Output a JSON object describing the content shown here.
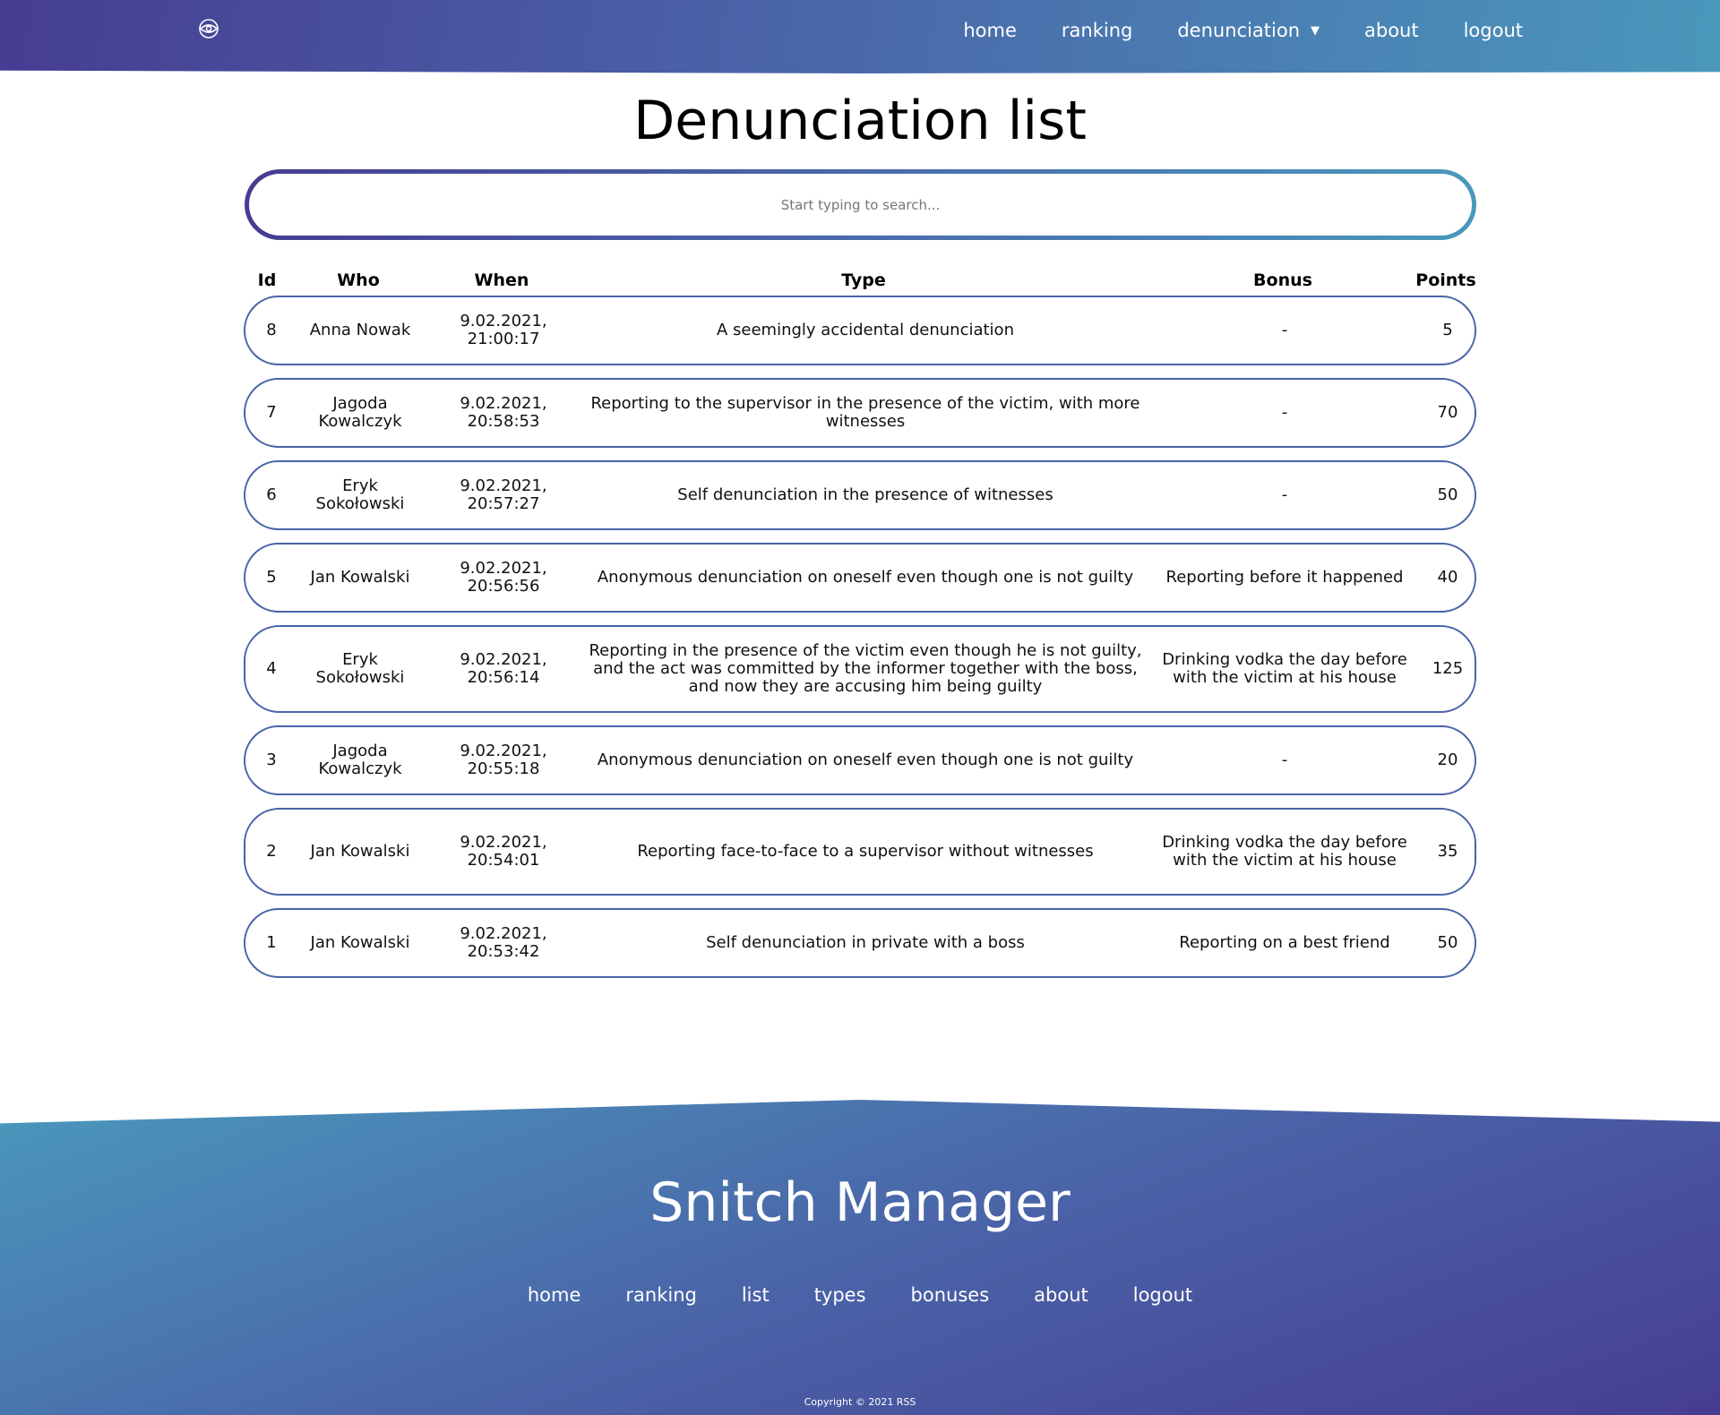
{
  "nav": {
    "logo_icon": "eye-icon",
    "items": [
      {
        "label": "home"
      },
      {
        "label": "ranking"
      },
      {
        "label": "denunciation",
        "caret": "▼"
      },
      {
        "label": "about"
      },
      {
        "label": "logout"
      }
    ]
  },
  "title": "Denunciation list",
  "search": {
    "placeholder": "Start typing to search...",
    "value": ""
  },
  "table": {
    "headers": {
      "id": "Id",
      "who": "Who",
      "when": "When",
      "type": "Type",
      "bonus": "Bonus",
      "points": "Points"
    },
    "rows": [
      {
        "id": "8",
        "who": "Anna Nowak",
        "when": "9.02.2021, 21:00:17",
        "type": "A seemingly accidental denunciation",
        "bonus": "-",
        "points": "5"
      },
      {
        "id": "7",
        "who": "Jagoda Kowalczyk",
        "when": "9.02.2021, 20:58:53",
        "type": "Reporting to the supervisor in the presence of the victim, with more witnesses",
        "bonus": "-",
        "points": "70"
      },
      {
        "id": "6",
        "who": "Eryk Sokołowski",
        "when": "9.02.2021, 20:57:27",
        "type": "Self denunciation in the presence of witnesses",
        "bonus": "-",
        "points": "50"
      },
      {
        "id": "5",
        "who": "Jan Kowalski",
        "when": "9.02.2021, 20:56:56",
        "type": "Anonymous denunciation on oneself even though one is not guilty",
        "bonus": "Reporting before it happened",
        "points": "40"
      },
      {
        "id": "4",
        "who": "Eryk Sokołowski",
        "when": "9.02.2021, 20:56:14",
        "type": "Reporting in the presence of the victim even though he is not guilty, and the act was committed by the informer together with the boss, and now they are accusing him being guilty",
        "bonus": "Drinking vodka the day before with the victim at his house",
        "points": "125"
      },
      {
        "id": "3",
        "who": "Jagoda Kowalczyk",
        "when": "9.02.2021, 20:55:18",
        "type": "Anonymous denunciation on oneself even though one is not guilty",
        "bonus": "-",
        "points": "20"
      },
      {
        "id": "2",
        "who": "Jan Kowalski",
        "when": "9.02.2021, 20:54:01",
        "type": "Reporting face-to-face to a supervisor without witnesses",
        "bonus": "Drinking vodka the day before with the victim at his house",
        "points": "35"
      },
      {
        "id": "1",
        "who": "Jan Kowalski",
        "when": "9.02.2021, 20:53:42",
        "type": "Self denunciation in private with a boss",
        "bonus": "Reporting on a best friend",
        "points": "50"
      }
    ]
  },
  "footer": {
    "brand": "Snitch Manager",
    "links": [
      {
        "label": "home"
      },
      {
        "label": "ranking"
      },
      {
        "label": "list"
      },
      {
        "label": "types"
      },
      {
        "label": "bonuses"
      },
      {
        "label": "about"
      },
      {
        "label": "logout"
      }
    ],
    "copyright": "Copyright © 2021 RSS"
  },
  "colors": {
    "gradient_start": "#463d92",
    "gradient_mid": "#4a64a8",
    "gradient_end": "#4a98bc",
    "row_border": "#4a64a8"
  }
}
